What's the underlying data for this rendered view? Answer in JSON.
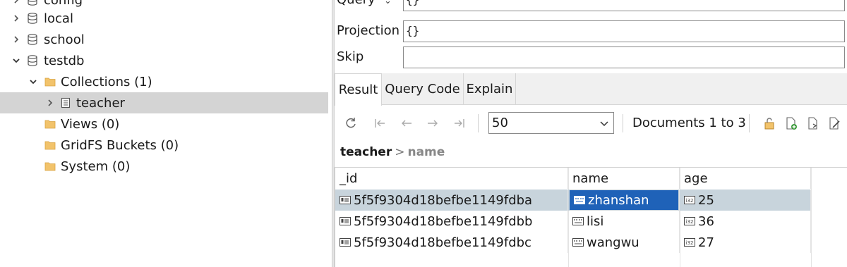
{
  "tree": {
    "items": [
      {
        "label": "config",
        "chevron": "right",
        "icon": "database"
      },
      {
        "label": "local",
        "chevron": "right",
        "icon": "database"
      },
      {
        "label": "school",
        "chevron": "right",
        "icon": "database"
      },
      {
        "label": "testdb",
        "chevron": "down",
        "icon": "database"
      },
      {
        "label": "Collections (1)",
        "chevron": "down",
        "icon": "folder"
      },
      {
        "label": "teacher",
        "chevron": "right",
        "icon": "collection",
        "selected": true
      },
      {
        "label": "Views (0)",
        "icon": "folder"
      },
      {
        "label": "GridFS Buckets (0)",
        "icon": "folder"
      },
      {
        "label": "System (0)",
        "icon": "folder"
      }
    ]
  },
  "query_form": {
    "query_label": "Query",
    "query_value": "{}",
    "projection_label": "Projection",
    "projection_value": "{}",
    "skip_label": "Skip",
    "skip_value": ""
  },
  "tabs": [
    {
      "label": "Result",
      "active": true
    },
    {
      "label": "Query Code"
    },
    {
      "label": "Explain"
    }
  ],
  "toolbar": {
    "page_size": "50",
    "doc_range": "Documents 1 to 3"
  },
  "breadcrumb": {
    "collection": "teacher",
    "field": "name"
  },
  "grid": {
    "columns": [
      "_id",
      "name",
      "age"
    ],
    "rows": [
      {
        "_id": "5f5f9304d18befbe1149fdba",
        "name": "zhanshan",
        "age": "25",
        "selected": true
      },
      {
        "_id": "5f5f9304d18befbe1149fdbb",
        "name": "lisi",
        "age": "36"
      },
      {
        "_id": "5f5f9304d18befbe1149fdbc",
        "name": "wangwu",
        "age": "27"
      }
    ]
  },
  "colors": {
    "selected_tree_row": "#d4d4d4",
    "selected_grid_row": "#c8d4dc",
    "selected_cell": "#1f62b8",
    "folder": "#f2c36b"
  }
}
